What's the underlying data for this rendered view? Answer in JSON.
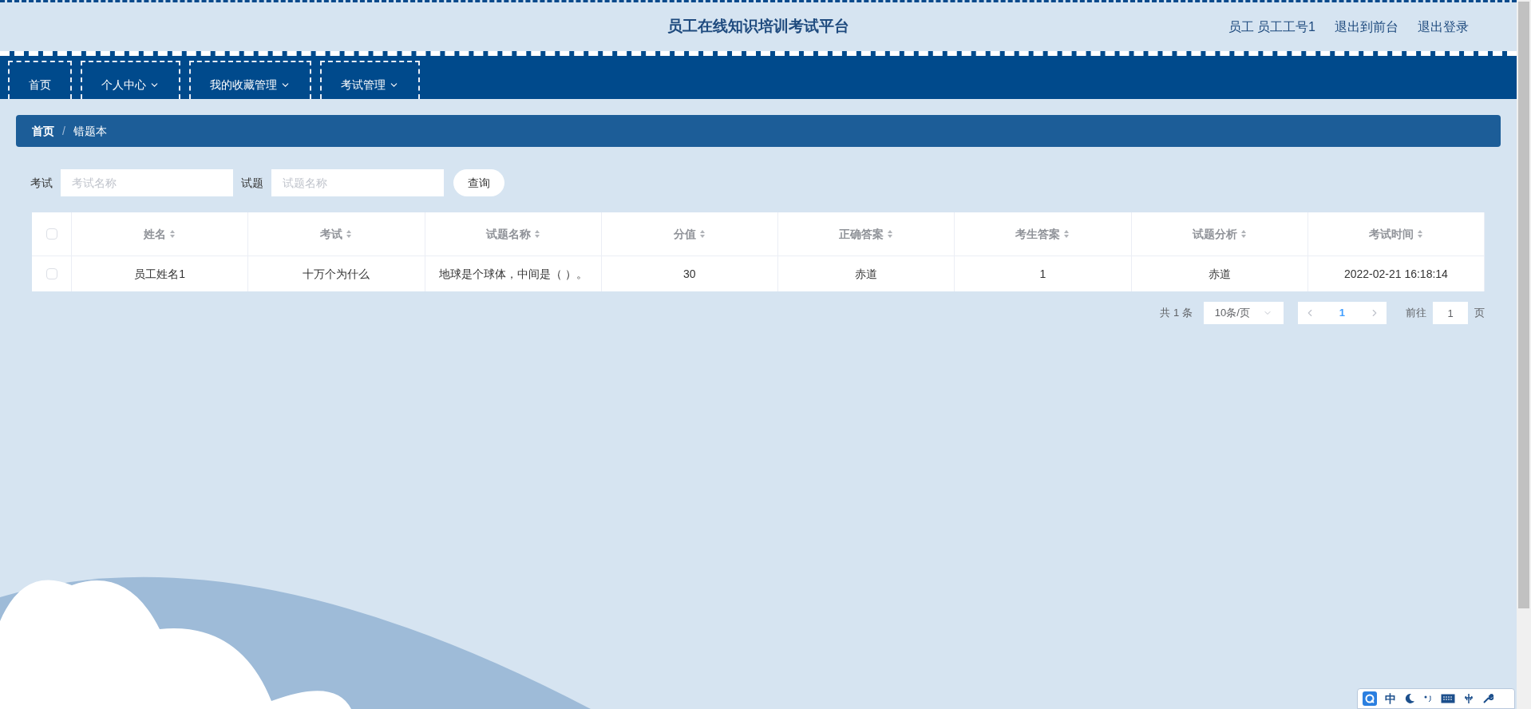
{
  "header": {
    "title": "员工在线知识培训考试平台",
    "user_role": "员工",
    "user_name": "员工工号1",
    "links": [
      "退出到前台",
      "退出登录"
    ]
  },
  "nav": [
    {
      "label": "首页",
      "dropdown": false
    },
    {
      "label": "个人中心",
      "dropdown": true
    },
    {
      "label": "我的收藏管理",
      "dropdown": true
    },
    {
      "label": "考试管理",
      "dropdown": true
    }
  ],
  "breadcrumb": [
    "首页",
    "错题本"
  ],
  "breadcrumb_separator": "/",
  "search": {
    "fields": [
      {
        "label": "考试",
        "placeholder": "考试名称"
      },
      {
        "label": "试题",
        "placeholder": "试题名称"
      }
    ],
    "button": "查询"
  },
  "table": {
    "header_checked": false,
    "columns": [
      "姓名",
      "考试",
      "试题名称",
      "分值",
      "正确答案",
      "考生答案",
      "试题分析",
      "考试时间"
    ],
    "rows": [
      {
        "checked": false,
        "cells": [
          "员工姓名1",
          "十万个为什么",
          "地球是个球体，中间是（ ）。",
          "30",
          "赤道",
          "1",
          "赤道",
          "2022-02-21 16:18:14"
        ]
      }
    ]
  },
  "pagination": {
    "total_prefix": "共",
    "total": "1",
    "total_suffix": "条",
    "page_size": "10条/页",
    "pages": [
      {
        "label": "1",
        "selected": true
      }
    ],
    "goto_label": "前往",
    "goto_value": "1",
    "goto_suffix": "页"
  },
  "ime_toolbar": {
    "mode": "中"
  }
}
